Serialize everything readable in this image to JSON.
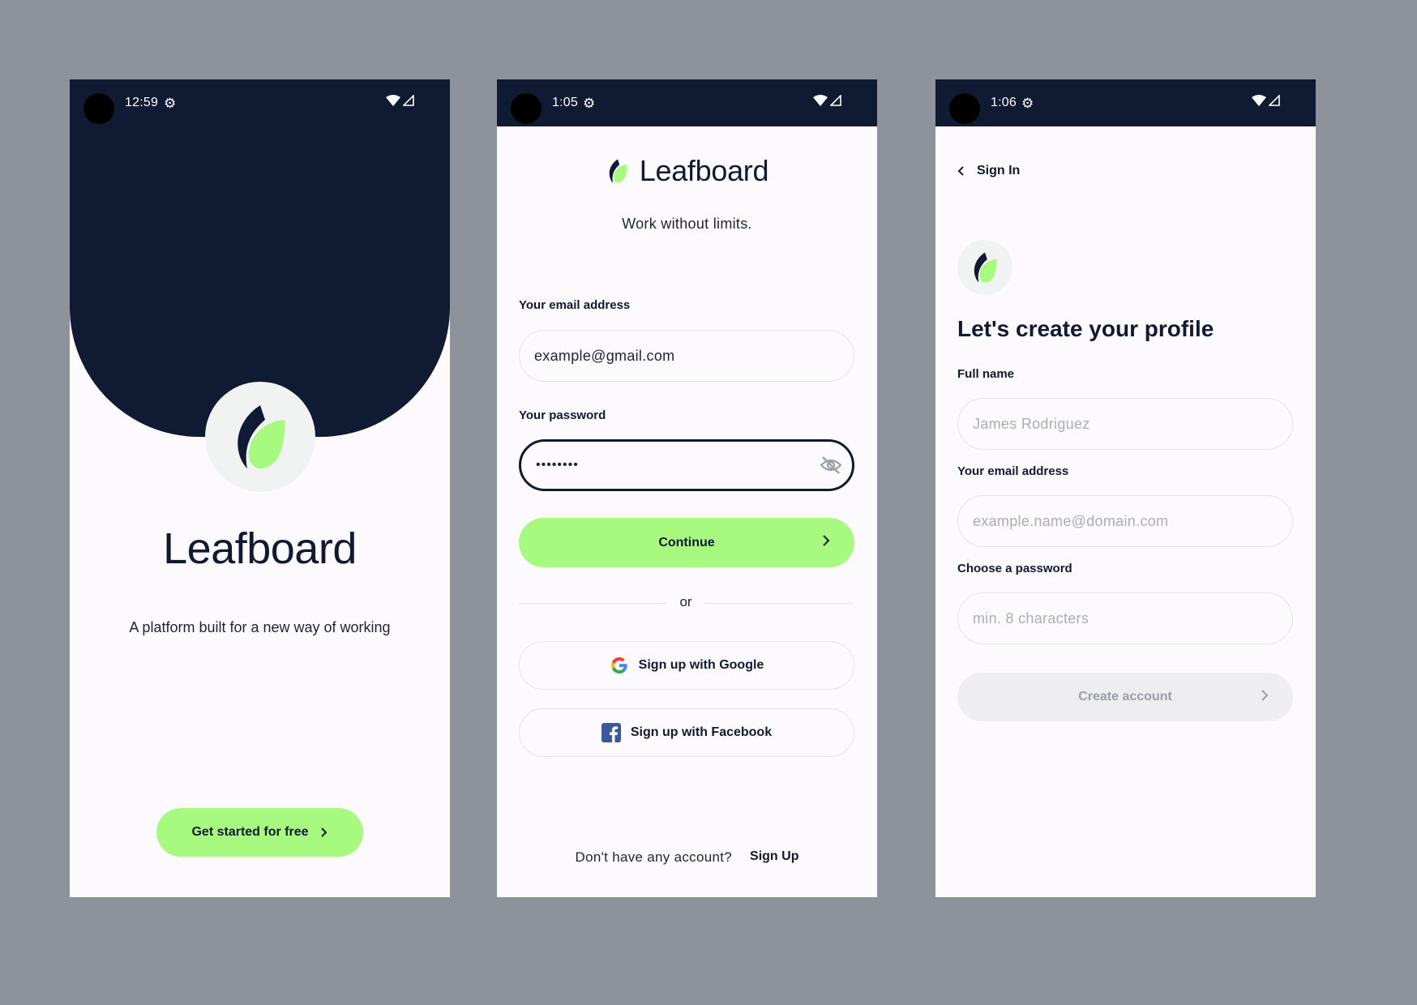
{
  "screens": {
    "welcome": {
      "status": {
        "time": "12:59"
      },
      "brand": "Leafboard",
      "tagline": "A platform built for a new way of working",
      "cta_label": "Get started for free"
    },
    "signin": {
      "status": {
        "time": "1:05"
      },
      "brand": "Leafboard",
      "tagline": "Work without limits.",
      "email_label": "Your email address",
      "email_value": "example@gmail.com",
      "password_label": "Your password",
      "password_value": "••••••••",
      "continue_label": "Continue",
      "or_label": "or",
      "google_label": "Sign up with Google",
      "facebook_label": "Sign up with Facebook",
      "footer_text": "Don't have any account?",
      "footer_link": "Sign Up"
    },
    "create": {
      "status": {
        "time": "1:06"
      },
      "back_label": "Sign In",
      "heading": "Let's create your profile",
      "name_label": "Full name",
      "name_placeholder": "James Rodriguez",
      "email_label": "Your email address",
      "email_placeholder": "example.name@domain.com",
      "password_label": "Choose a password",
      "password_placeholder": "min. 8 characters",
      "submit_label": "Create account"
    }
  },
  "icons": {
    "logo": "leaf-logo-icon",
    "gear": "gear-icon",
    "wifi": "wifi-icon",
    "signal": "signal-icon",
    "eye": "eye-off-icon",
    "chevron": "chevron-right-icon",
    "back": "chevron-left-icon",
    "google": "google-icon",
    "facebook": "facebook-icon"
  },
  "colors": {
    "navy": "#111a33",
    "accent": "#a7f97f",
    "background": "#8e929b",
    "surface": "#fdfafd"
  }
}
